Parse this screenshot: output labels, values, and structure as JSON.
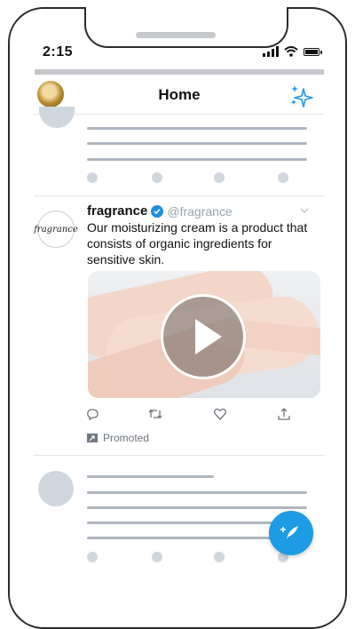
{
  "status_bar": {
    "time": "2:15"
  },
  "header": {
    "title": "Home"
  },
  "tweet": {
    "name": "fragrance",
    "handle": "@fragrance",
    "avatar_text": "fragrance",
    "text": "Our moisturizing cream is a product that consists of organic ingredients for sensitive skin.",
    "promoted_label": "Promoted"
  },
  "icons": {
    "status": [
      "signal-icon",
      "wifi-icon",
      "battery-icon"
    ],
    "header_right": "sparkle-icon",
    "actions": [
      "reply-icon",
      "retweet-icon",
      "like-icon",
      "share-icon"
    ],
    "fab": "compose-tweet-icon"
  },
  "colors": {
    "accent": "#1d9be4",
    "verified": "#1d8fe0",
    "placeholder": "#cfd6de",
    "skeleton_line": "#aeb6bf"
  }
}
